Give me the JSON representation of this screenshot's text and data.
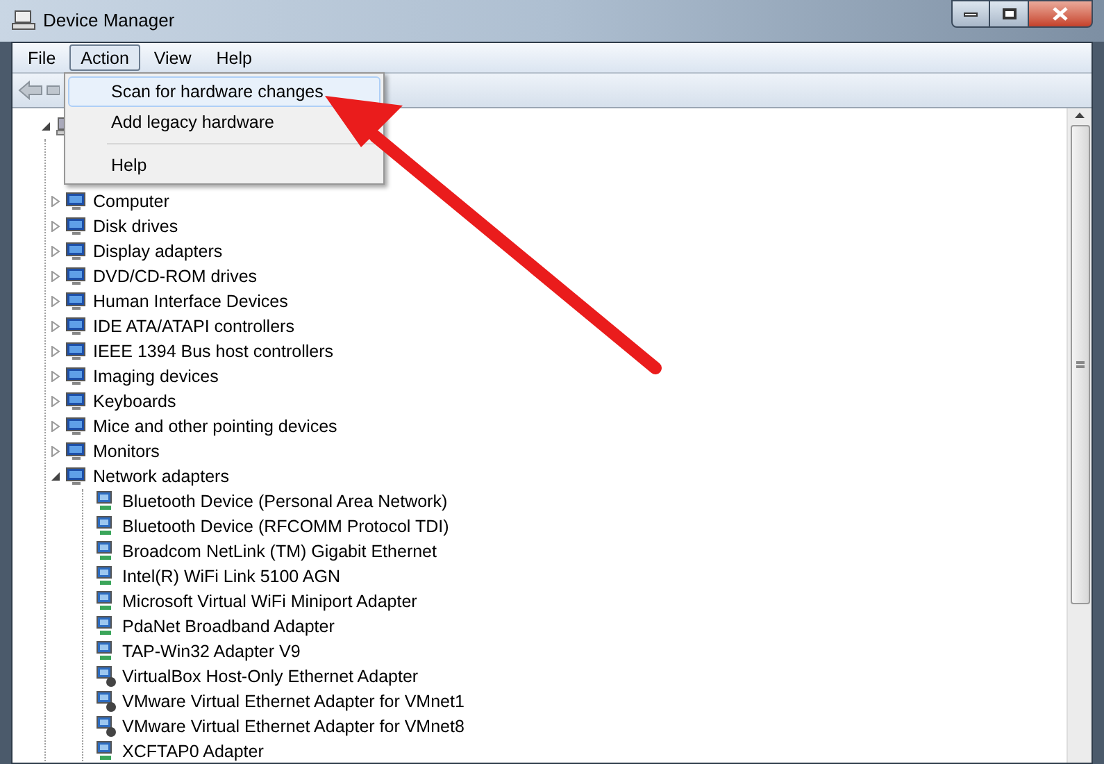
{
  "window": {
    "title": "Device Manager"
  },
  "menu_bar": [
    {
      "label": "File",
      "selected": false
    },
    {
      "label": "Action",
      "selected": true
    },
    {
      "label": "View",
      "selected": false
    },
    {
      "label": "Help",
      "selected": false
    }
  ],
  "action_menu": [
    {
      "kind": "item",
      "label": "Scan for hardware changes",
      "selected": true
    },
    {
      "kind": "item",
      "label": "Add legacy hardware",
      "selected": false
    },
    {
      "kind": "separator"
    },
    {
      "kind": "item",
      "label": "Help",
      "selected": false
    }
  ],
  "tree": {
    "expanded": true,
    "children": [
      {
        "label": "Computer",
        "expanded": false
      },
      {
        "label": "Disk drives",
        "expanded": false
      },
      {
        "label": "Display adapters",
        "expanded": false
      },
      {
        "label": "DVD/CD-ROM drives",
        "expanded": false
      },
      {
        "label": "Human Interface Devices",
        "expanded": false
      },
      {
        "label": "IDE ATA/ATAPI controllers",
        "expanded": false
      },
      {
        "label": "IEEE 1394 Bus host controllers",
        "expanded": false
      },
      {
        "label": "Imaging devices",
        "expanded": false
      },
      {
        "label": "Keyboards",
        "expanded": false
      },
      {
        "label": "Mice and other pointing devices",
        "expanded": false
      },
      {
        "label": "Monitors",
        "expanded": false
      },
      {
        "label": "Network adapters",
        "expanded": true,
        "children": [
          {
            "label": "Bluetooth Device (Personal Area Network)",
            "kind": "adapter"
          },
          {
            "label": "Bluetooth Device (RFCOMM Protocol TDI)",
            "kind": "adapter"
          },
          {
            "label": "Broadcom NetLink (TM) Gigabit Ethernet",
            "kind": "adapter"
          },
          {
            "label": "Intel(R) WiFi Link 5100 AGN",
            "kind": "adapter"
          },
          {
            "label": "Microsoft Virtual WiFi Miniport Adapter",
            "kind": "adapter"
          },
          {
            "label": "PdaNet Broadband Adapter",
            "kind": "adapter"
          },
          {
            "label": "TAP-Win32 Adapter V9",
            "kind": "adapter"
          },
          {
            "label": "VirtualBox Host-Only Ethernet Adapter",
            "kind": "virtual"
          },
          {
            "label": "VMware Virtual Ethernet Adapter for VMnet1",
            "kind": "virtual"
          },
          {
            "label": "VMware Virtual Ethernet Adapter for VMnet8",
            "kind": "virtual"
          },
          {
            "label": "XCFTAP0 Adapter",
            "kind": "adapter"
          }
        ]
      }
    ]
  }
}
